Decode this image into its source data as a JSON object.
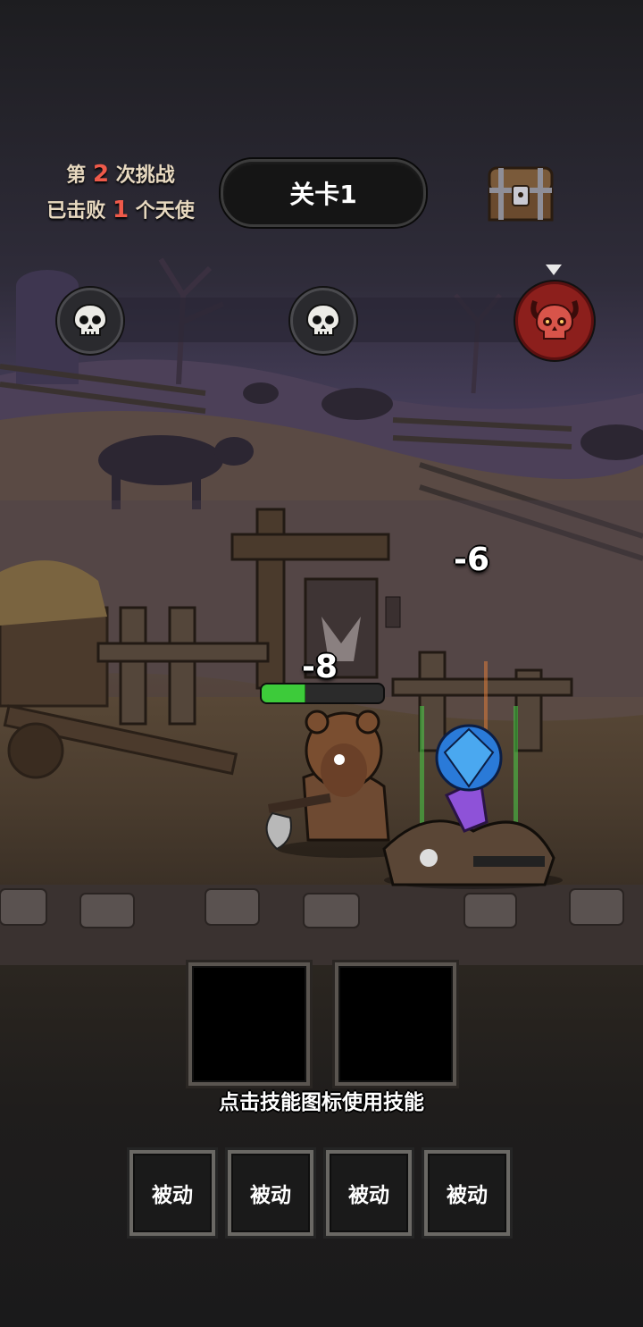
{
  "header": {
    "attempt_prefix": "第",
    "attempt_count": "2",
    "attempt_suffix": "次挑战",
    "defeated_prefix": "已击败",
    "defeated_count": "1",
    "defeated_suffix": "个天使",
    "stage_label": "关卡1"
  },
  "progress": {
    "nodes": [
      {
        "type": "skull",
        "icon": "skull-icon"
      },
      {
        "type": "skull",
        "icon": "skull-icon"
      },
      {
        "type": "boss",
        "icon": "demon-skull-icon",
        "current": true
      }
    ]
  },
  "battle": {
    "damage_enemy": "-6",
    "damage_player": "-8",
    "player_hp_fraction": 0.35,
    "player": "bear-hooded-barbarian",
    "enemy": "boar-beast-with-gem"
  },
  "skills": {
    "slots": [
      "",
      ""
    ],
    "hint": "点击技能图标使用技能"
  },
  "passives": {
    "labels": [
      "被动",
      "被动",
      "被动",
      "被动"
    ]
  },
  "colors": {
    "highlight_number": "#ef5a4a",
    "hp_green": "#3dcb3a",
    "boss_red": "#8c1f1c"
  }
}
